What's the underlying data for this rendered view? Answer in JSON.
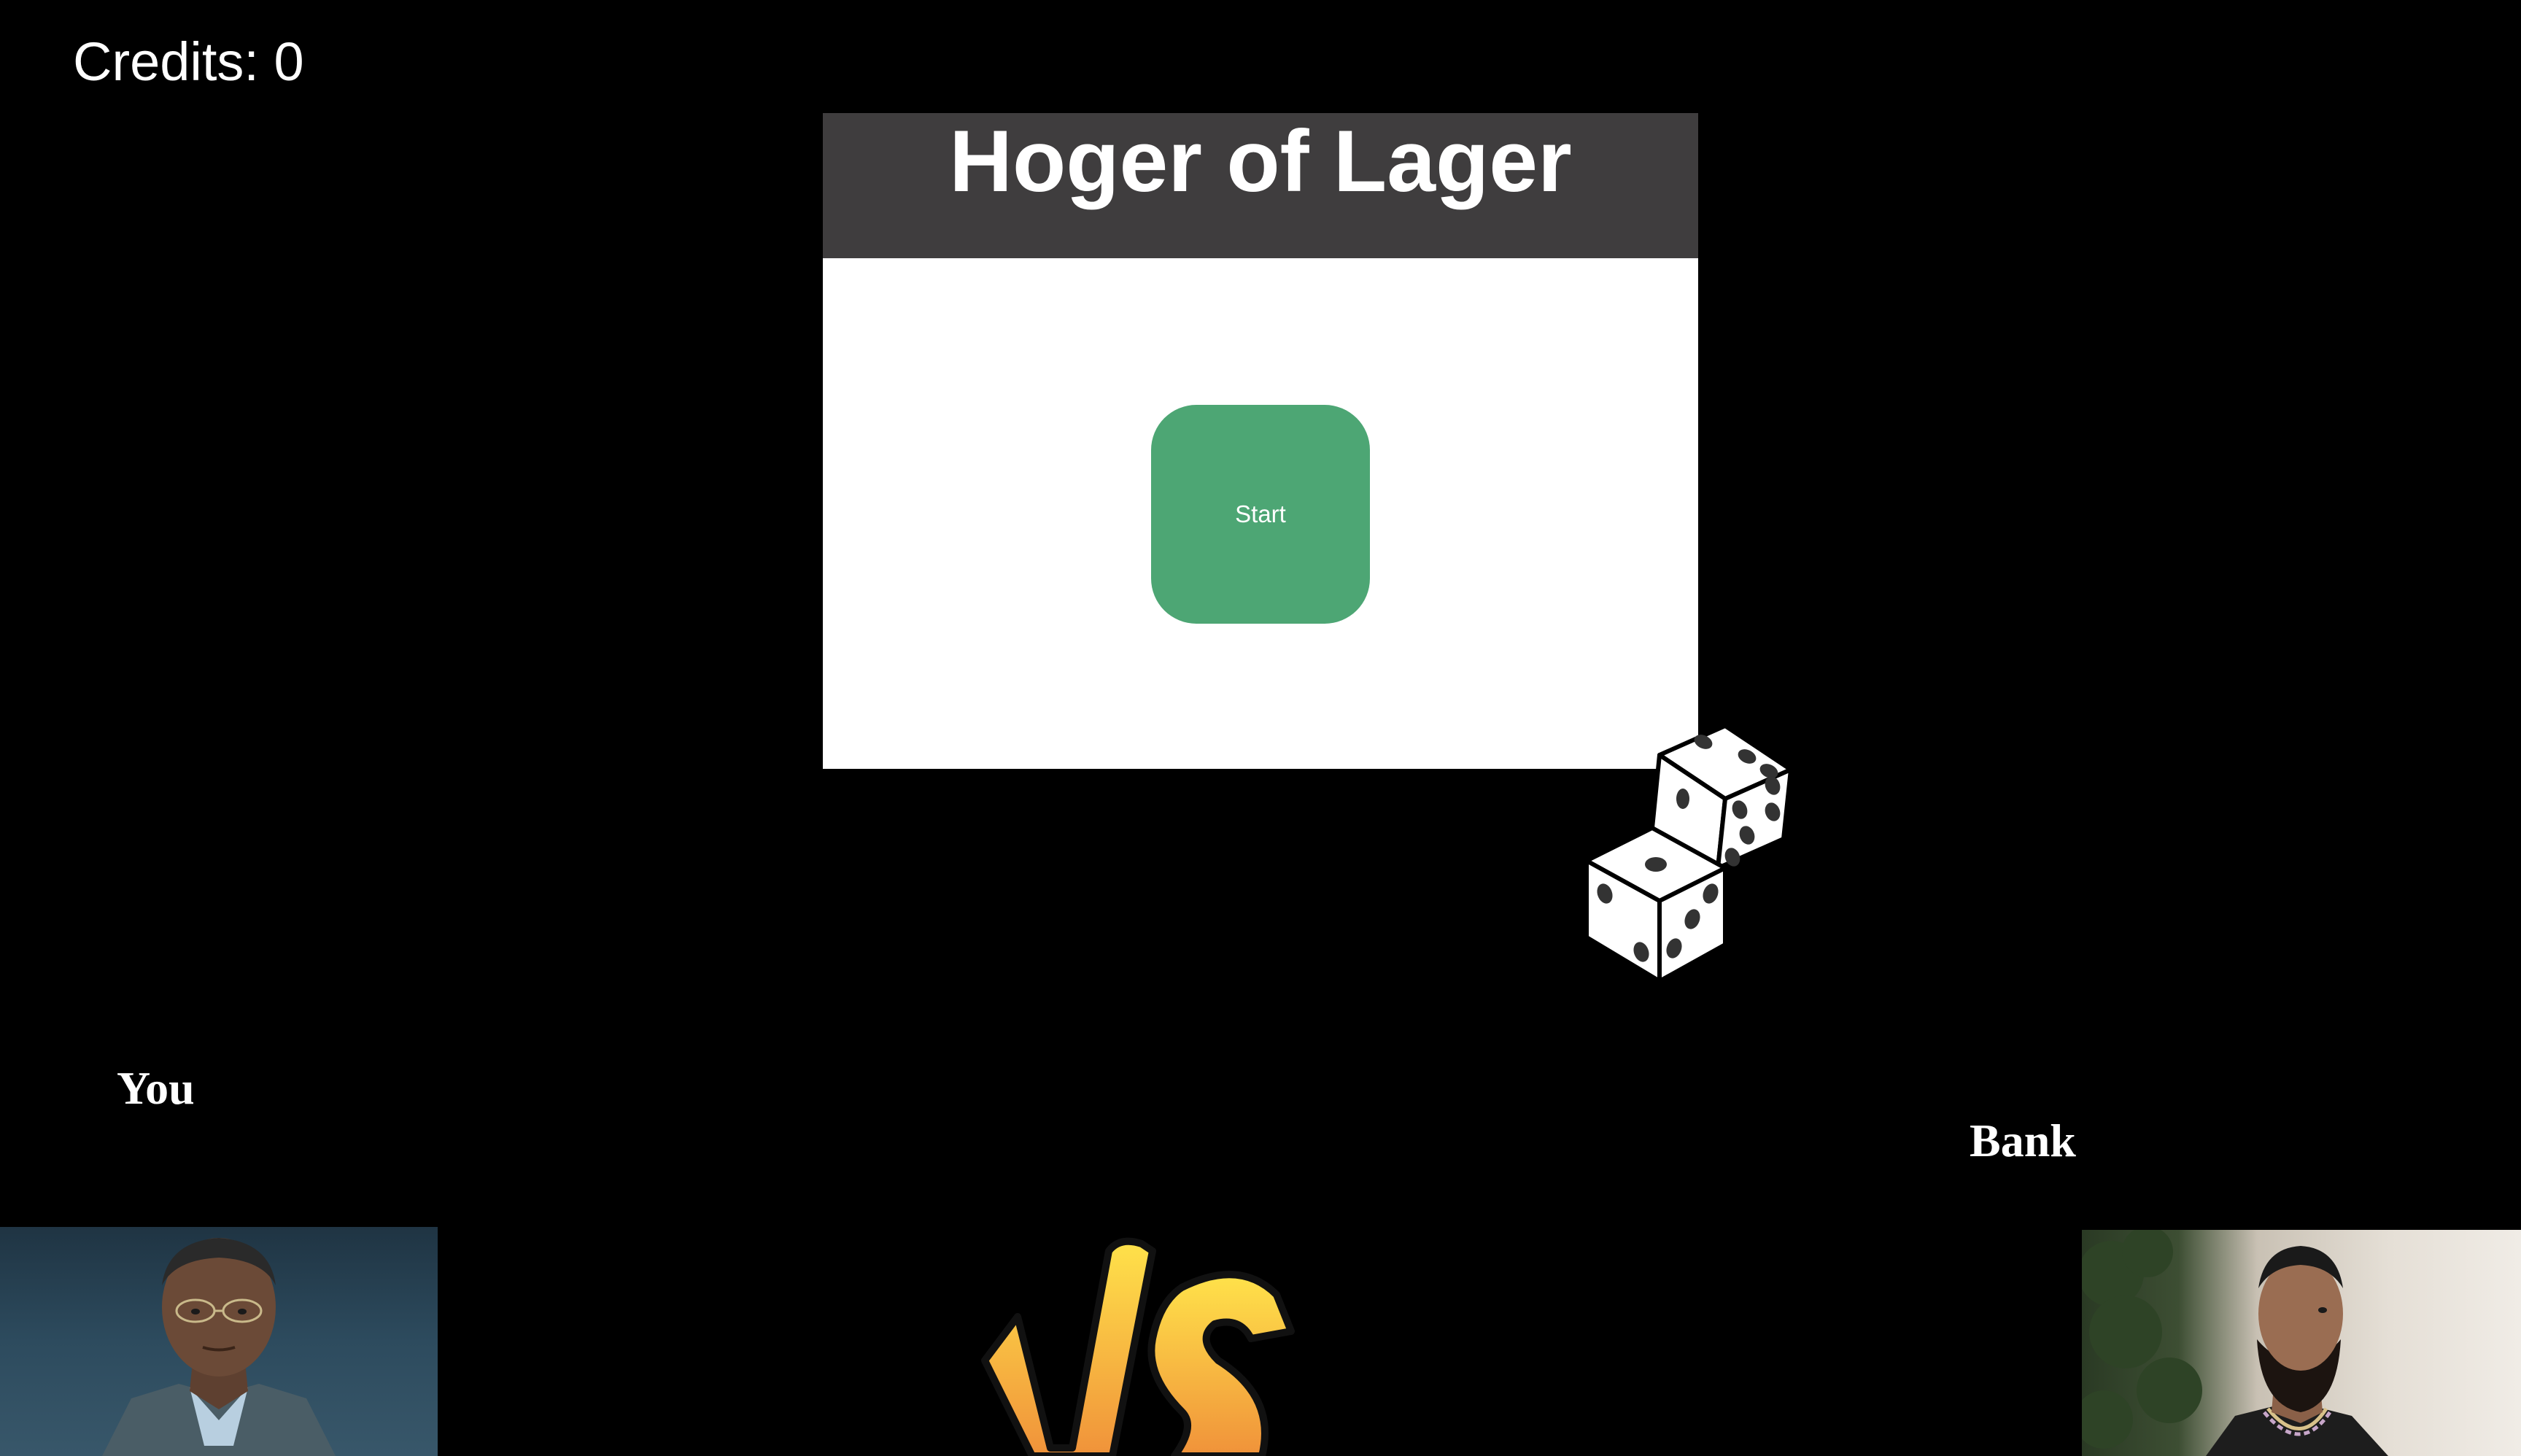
{
  "hud": {
    "credits_text": "Credits: 0"
  },
  "panel": {
    "title": "Hoger of Lager",
    "start_label": "Start"
  },
  "players": {
    "you_label": "You",
    "bank_label": "Bank"
  },
  "colors": {
    "background": "#000000",
    "header": "#3f3d3e",
    "start_button": "#4da674",
    "vs_gradient_top": "#ffe24a",
    "vs_gradient_bottom": "#f0923a"
  },
  "icons": {
    "dice": "dice-icon",
    "vs": "vs-logo"
  }
}
